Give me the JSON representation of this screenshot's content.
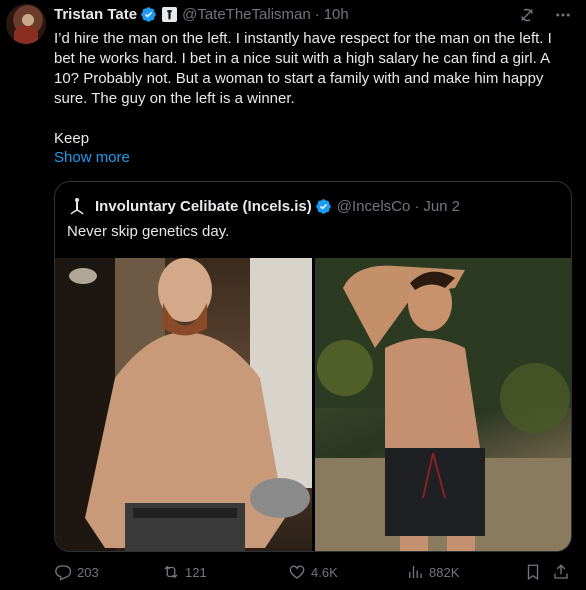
{
  "author": {
    "name": "Tristan Tate",
    "handle": "@TateTheTalisman",
    "time": "10h",
    "verified_color": "#1d9bf0"
  },
  "tweet": {
    "paragraphs": [
      "I’d hire the man on the left. I instantly have respect for the man on the left. I bet he works hard. I bet in a nice suit with a high salary he can find a girl. A 10? Probably not. But a woman to start a family with and make him happy sure. The guy on the left is a winner.",
      "Keep"
    ],
    "show_more": "Show more"
  },
  "quoted_tweet": {
    "name": "Involuntary Celibate (Incels.is)",
    "handle": "@IncelsCo",
    "date": "Jun 2",
    "text": "Never skip genetics day."
  },
  "metrics": {
    "replies": "203",
    "retweets": "121",
    "likes": "4.6K",
    "views": "882K"
  },
  "icons": [
    "grok-icon",
    "more-icon",
    "verified-badge-icon",
    "reply-icon",
    "retweet-icon",
    "like-icon",
    "views-icon",
    "bookmark-icon",
    "share-icon"
  ],
  "colors": {
    "background": "#000000",
    "text": "#e7e9ea",
    "muted": "#71767b",
    "link": "#1d9bf0",
    "border": "#2f3336"
  }
}
